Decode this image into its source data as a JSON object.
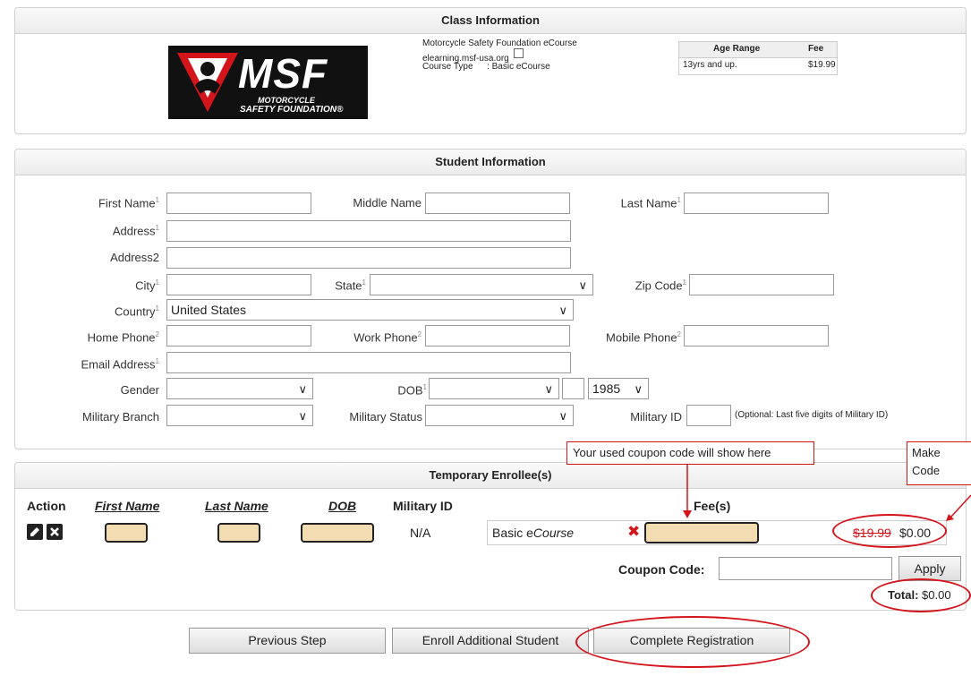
{
  "class_info": {
    "header": "Class Information",
    "logo": {
      "big": "MSF",
      "line1": "MOTORCYCLE",
      "line2": "SAFETY FOUNDATION®"
    },
    "course_name": "Motorcycle Safety Foundation eCourse",
    "website": "elearning.msf-usa.org",
    "course_type_label": "Course Type",
    "course_type_sep": ":",
    "course_type_value": "Basic eCourse",
    "age_table": {
      "col_age": "Age Range",
      "col_fee": "Fee",
      "age": "13yrs and up.",
      "fee": "$19.99"
    }
  },
  "student_info": {
    "header": "Student Information",
    "labels": {
      "first_name": "First Name",
      "middle_name": "Middle Name",
      "last_name": "Last Name",
      "address": "Address",
      "address2": "Address2",
      "city": "City",
      "state": "State",
      "zip": "Zip Code",
      "country": "Country",
      "home_phone": "Home Phone",
      "work_phone": "Work Phone",
      "mobile_phone": "Mobile Phone",
      "email": "Email Address",
      "gender": "Gender",
      "dob": "DOB",
      "military_branch": "Military Branch",
      "military_status": "Military Status",
      "military_id": "Military ID"
    },
    "sup1": "1",
    "sup2": "2",
    "country_value": "United States",
    "dob_year": "1985",
    "military_id_hint": "(Optional: Last five digits of Military ID)"
  },
  "enrollees": {
    "header": "Temporary Enrollee(s)",
    "columns": {
      "action": "Action",
      "first_name": "First Name",
      "last_name": "Last Name",
      "dob": "DOB",
      "military_id": "Military ID",
      "fees": "Fee(s)"
    },
    "row": {
      "military_id": "N/A",
      "course_prefix": "Basic e",
      "course_suffix": "Course",
      "old_fee": "$19.99",
      "new_fee": "$0.00"
    },
    "coupon_label": "Coupon Code:",
    "apply_label": "Apply",
    "total_label": "Total:",
    "total_value": "$0.00"
  },
  "actions": {
    "previous": "Previous Step",
    "enroll_additional": "Enroll Additional Student",
    "complete": "Complete Registration"
  },
  "annotations": {
    "coupon_note": "Your used coupon code will show here",
    "right_note_line1": "Make",
    "right_note_line2": "Code"
  },
  "colors": {
    "annotation_red": "#d4141b",
    "highlight_tan": "#f3dcb2"
  }
}
